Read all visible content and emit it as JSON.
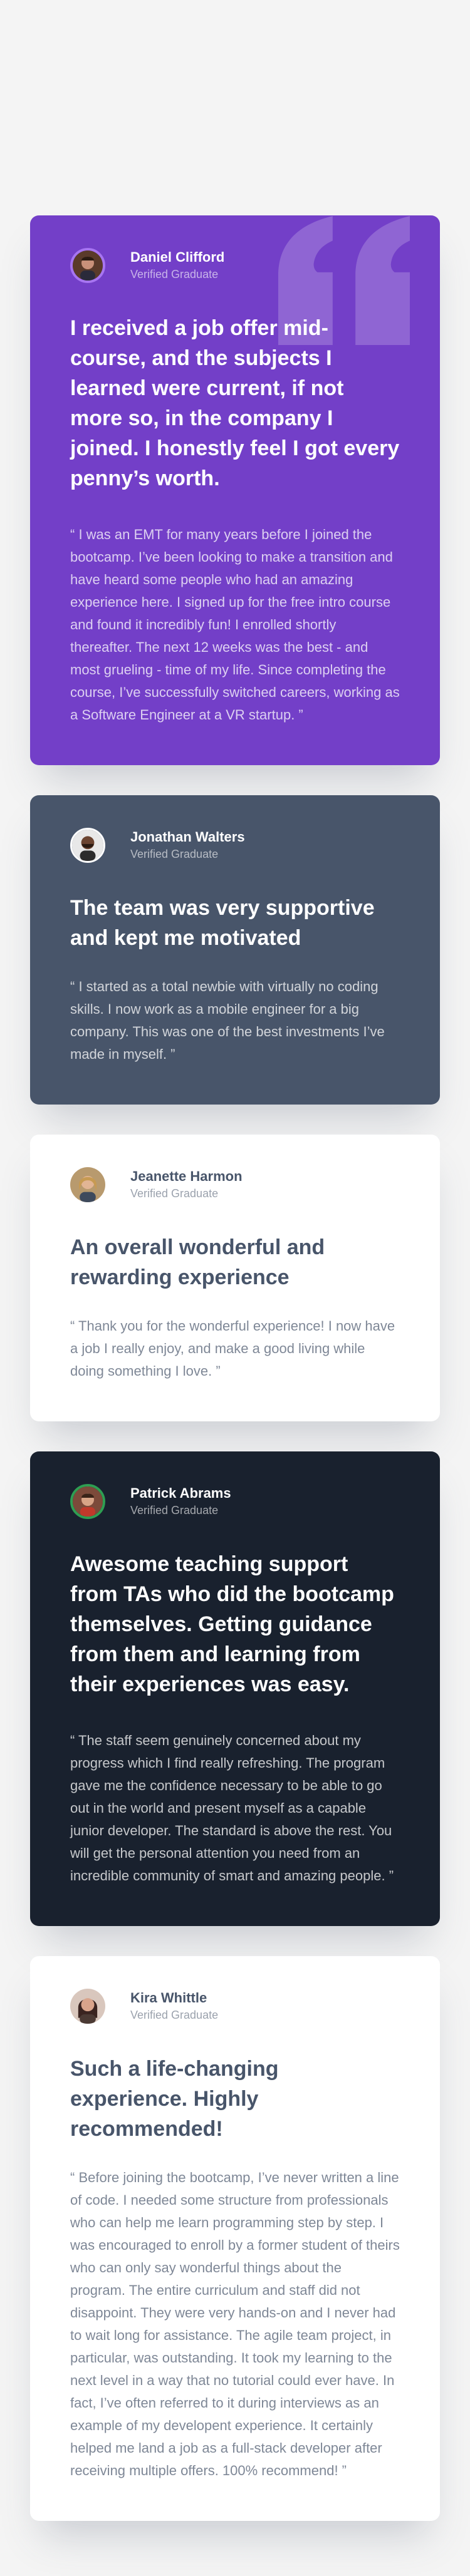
{
  "colors": {
    "page_bg": "#f4f4f4",
    "purple": "#733fc8",
    "gray_blue": "#48556a",
    "white": "#ffffff",
    "dark": "#19212e",
    "accent_light_purple": "#a775f1"
  },
  "testimonials": [
    {
      "name": "Daniel Clifford",
      "role": "Verified Graduate",
      "headline": "I received a job offer mid-course, and the subjects I learned were current, if not more so, in the company I joined. I honestly feel I got every penny’s worth.",
      "body": "“ I was an EMT for many years before I joined the bootcamp. I’ve been looking to make a transition and have heard some people who had an amazing experience here. I signed up for the free intro course and found it incredibly fun! I enrolled shortly thereafter. The next 12 weeks was the best - and most grueling - time of my life. Since completing the course, I’ve successfully switched careers, working as a Software Engineer at a VR startup. ”",
      "avatar_icon": "avatar-daniel",
      "quote_icon": "quote-mark-icon"
    },
    {
      "name": "Jonathan Walters",
      "role": "Verified Graduate",
      "headline": "The team was very supportive and kept me motivated",
      "body": "“ I started as a total newbie with virtually no coding skills. I now work as a mobile engineer for a big company. This was one of the best investments I’ve made in myself. ”",
      "avatar_icon": "avatar-jonathan"
    },
    {
      "name": "Jeanette Harmon",
      "role": "Verified Graduate",
      "headline": "An overall wonderful and rewarding experience",
      "body": "“ Thank you for the wonderful experience! I now have a job I really enjoy, and make a good living while doing something I love. ”",
      "avatar_icon": "avatar-jeanette"
    },
    {
      "name": "Patrick Abrams",
      "role": "Verified Graduate",
      "headline": "Awesome teaching support from TAs who did the bootcamp themselves. Getting guidance from them and learning from their experiences was easy.",
      "body": "“ The staff seem genuinely concerned about my progress which I find really refreshing. The program gave me the confidence necessary to be able to go out in the world and present myself as a capable junior developer. The standard is above the rest. You will get the personal attention you need from an incredible community of smart and amazing people. ”",
      "avatar_icon": "avatar-patrick"
    },
    {
      "name": "Kira Whittle",
      "role": "Verified Graduate",
      "headline": "Such a life-changing experience. Highly recommended!",
      "body": "“ Before joining the bootcamp, I’ve never written a line of code. I needed some structure from professionals who can help me learn programming step by step. I was encouraged to enroll by a former student of theirs who can only say wonderful things about the program. The entire curriculum and staff did not disappoint. They were very hands-on and I never had to wait long for assistance. The agile team project, in particular, was outstanding. It took my learning to the next level in a way that no tutorial could ever have. In fact, I’ve often referred to it during interviews as an example of my developent experience. It certainly helped me land a job as a full-stack developer after receiving multiple offers. 100% recommend! ”",
      "avatar_icon": "avatar-kira"
    }
  ]
}
